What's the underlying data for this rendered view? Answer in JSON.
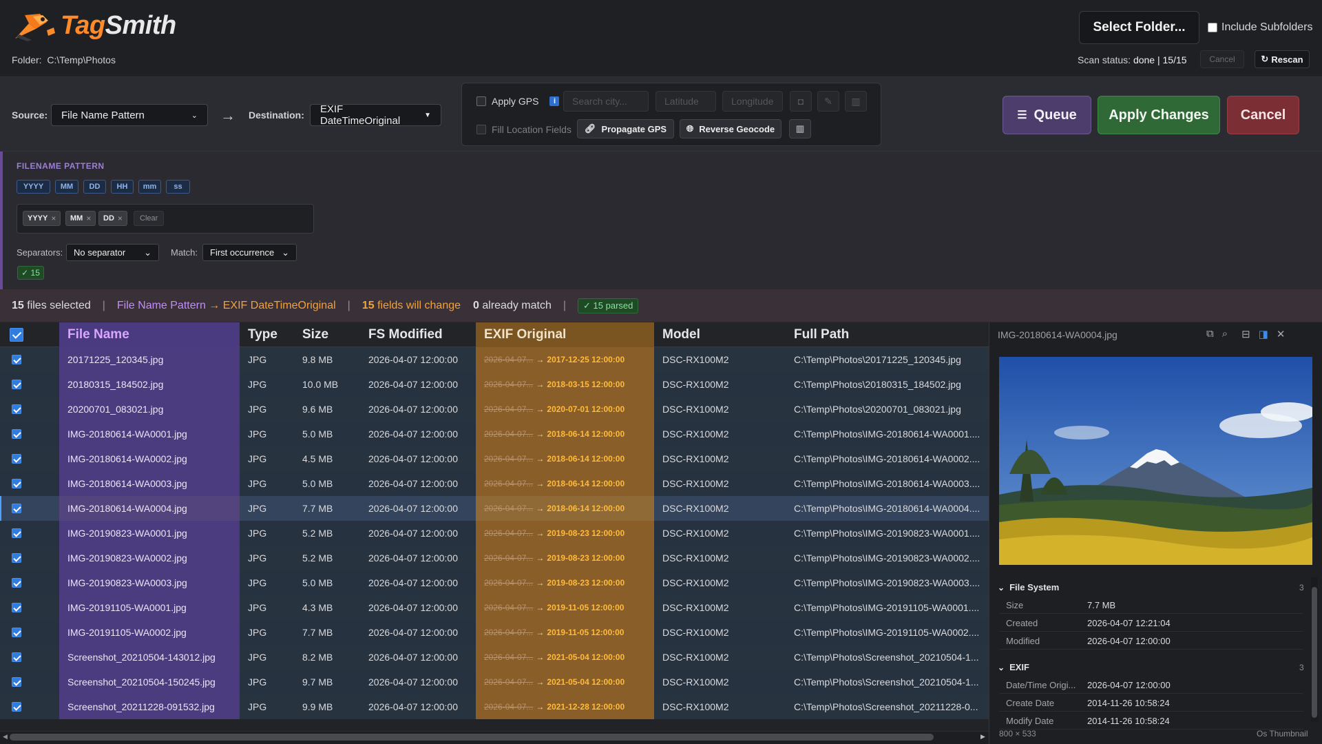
{
  "app": {
    "name_part1": "Tag",
    "name_part2": "Smith"
  },
  "header": {
    "folder_label": "Folder:",
    "folder_path": "C:\\Temp\\Photos",
    "select_folder": "Select Folder...",
    "include_subfolders": "Include Subfolders",
    "scan_status_label": "Scan status:",
    "scan_status_value": "done | 15/15",
    "cancel_small": "Cancel",
    "rescan": "Rescan"
  },
  "toolbar": {
    "source_label": "Source:",
    "source_value": "File Name Pattern",
    "destination_label": "Destination:",
    "destination_value": "EXIF DateTimeOriginal",
    "apply_gps": "Apply GPS",
    "search_city_placeholder": "Search city...",
    "latitude_placeholder": "Latitude",
    "longitude_placeholder": "Longitude",
    "fill_location": "Fill Location Fields",
    "propagate_gps": "Propagate GPS",
    "reverse_geocode": "Reverse Geocode",
    "queue": "Queue",
    "apply_changes": "Apply Changes",
    "cancel": "Cancel"
  },
  "pattern": {
    "title": "FILENAME PATTERN",
    "tokens": [
      "YYYY",
      "MM",
      "DD",
      "HH",
      "mm",
      "ss"
    ],
    "chips": [
      "YYYY",
      "MM",
      "DD"
    ],
    "clear": "Clear",
    "separators_label": "Separators:",
    "separators_value": "No separator",
    "match_label": "Match:",
    "match_value": "First occurrence",
    "parsed_badge": "✓ 15"
  },
  "summary": {
    "files_selected_count": "15",
    "files_selected_text": "files selected",
    "source": "File Name Pattern",
    "arrow": "→",
    "destination": "EXIF DateTimeOriginal",
    "fields_change_count": "15",
    "fields_change_text": "fields will change",
    "already_match_count": "0",
    "already_match_text": "already match",
    "parsed_badge": "✓ 15 parsed"
  },
  "table": {
    "headers": [
      "File Name",
      "Type",
      "Size",
      "FS Modified",
      "EXIF Original",
      "Model",
      "Full Path"
    ],
    "rows": [
      {
        "name": "20171225_120345.jpg",
        "type": "JPG",
        "size": "9.8 MB",
        "fs": "2026-04-07 12:00:00",
        "old": "2026-04-07...",
        "new": "2017-12-25 12:00:00",
        "model": "DSC-RX100M2",
        "path": "C:\\Temp\\Photos\\20171225_120345.jpg"
      },
      {
        "name": "20180315_184502.jpg",
        "type": "JPG",
        "size": "10.0 MB",
        "fs": "2026-04-07 12:00:00",
        "old": "2026-04-07...",
        "new": "2018-03-15 12:00:00",
        "model": "DSC-RX100M2",
        "path": "C:\\Temp\\Photos\\20180315_184502.jpg"
      },
      {
        "name": "20200701_083021.jpg",
        "type": "JPG",
        "size": "9.6 MB",
        "fs": "2026-04-07 12:00:00",
        "old": "2026-04-07...",
        "new": "2020-07-01 12:00:00",
        "model": "DSC-RX100M2",
        "path": "C:\\Temp\\Photos\\20200701_083021.jpg"
      },
      {
        "name": "IMG-20180614-WA0001.jpg",
        "type": "JPG",
        "size": "5.0 MB",
        "fs": "2026-04-07 12:00:00",
        "old": "2026-04-07...",
        "new": "2018-06-14 12:00:00",
        "model": "DSC-RX100M2",
        "path": "C:\\Temp\\Photos\\IMG-20180614-WA0001...."
      },
      {
        "name": "IMG-20180614-WA0002.jpg",
        "type": "JPG",
        "size": "4.5 MB",
        "fs": "2026-04-07 12:00:00",
        "old": "2026-04-07...",
        "new": "2018-06-14 12:00:00",
        "model": "DSC-RX100M2",
        "path": "C:\\Temp\\Photos\\IMG-20180614-WA0002...."
      },
      {
        "name": "IMG-20180614-WA0003.jpg",
        "type": "JPG",
        "size": "5.0 MB",
        "fs": "2026-04-07 12:00:00",
        "old": "2026-04-07...",
        "new": "2018-06-14 12:00:00",
        "model": "DSC-RX100M2",
        "path": "C:\\Temp\\Photos\\IMG-20180614-WA0003...."
      },
      {
        "name": "IMG-20180614-WA0004.jpg",
        "type": "JPG",
        "size": "7.7 MB",
        "fs": "2026-04-07 12:00:00",
        "old": "2026-04-07...",
        "new": "2018-06-14 12:00:00",
        "model": "DSC-RX100M2",
        "path": "C:\\Temp\\Photos\\IMG-20180614-WA0004...."
      },
      {
        "name": "IMG-20190823-WA0001.jpg",
        "type": "JPG",
        "size": "5.2 MB",
        "fs": "2026-04-07 12:00:00",
        "old": "2026-04-07...",
        "new": "2019-08-23 12:00:00",
        "model": "DSC-RX100M2",
        "path": "C:\\Temp\\Photos\\IMG-20190823-WA0001...."
      },
      {
        "name": "IMG-20190823-WA0002.jpg",
        "type": "JPG",
        "size": "5.2 MB",
        "fs": "2026-04-07 12:00:00",
        "old": "2026-04-07...",
        "new": "2019-08-23 12:00:00",
        "model": "DSC-RX100M2",
        "path": "C:\\Temp\\Photos\\IMG-20190823-WA0002...."
      },
      {
        "name": "IMG-20190823-WA0003.jpg",
        "type": "JPG",
        "size": "5.0 MB",
        "fs": "2026-04-07 12:00:00",
        "old": "2026-04-07...",
        "new": "2019-08-23 12:00:00",
        "model": "DSC-RX100M2",
        "path": "C:\\Temp\\Photos\\IMG-20190823-WA0003...."
      },
      {
        "name": "IMG-20191105-WA0001.jpg",
        "type": "JPG",
        "size": "4.3 MB",
        "fs": "2026-04-07 12:00:00",
        "old": "2026-04-07...",
        "new": "2019-11-05 12:00:00",
        "model": "DSC-RX100M2",
        "path": "C:\\Temp\\Photos\\IMG-20191105-WA0001...."
      },
      {
        "name": "IMG-20191105-WA0002.jpg",
        "type": "JPG",
        "size": "7.7 MB",
        "fs": "2026-04-07 12:00:00",
        "old": "2026-04-07...",
        "new": "2019-11-05 12:00:00",
        "model": "DSC-RX100M2",
        "path": "C:\\Temp\\Photos\\IMG-20191105-WA0002...."
      },
      {
        "name": "Screenshot_20210504-143012.jpg",
        "type": "JPG",
        "size": "8.2 MB",
        "fs": "2026-04-07 12:00:00",
        "old": "2026-04-07...",
        "new": "2021-05-04 12:00:00",
        "model": "DSC-RX100M2",
        "path": "C:\\Temp\\Photos\\Screenshot_20210504-1..."
      },
      {
        "name": "Screenshot_20210504-150245.jpg",
        "type": "JPG",
        "size": "9.7 MB",
        "fs": "2026-04-07 12:00:00",
        "old": "2026-04-07...",
        "new": "2021-05-04 12:00:00",
        "model": "DSC-RX100M2",
        "path": "C:\\Temp\\Photos\\Screenshot_20210504-1..."
      },
      {
        "name": "Screenshot_20211228-091532.jpg",
        "type": "JPG",
        "size": "9.9 MB",
        "fs": "2026-04-07 12:00:00",
        "old": "2026-04-07...",
        "new": "2021-12-28 12:00:00",
        "model": "DSC-RX100M2",
        "path": "C:\\Temp\\Photos\\Screenshot_20211228-0..."
      }
    ],
    "selected_row_index": 6
  },
  "preview": {
    "title": "IMG-20180614-WA0004.jpg",
    "sections": [
      {
        "name": "File System",
        "count": "3",
        "items": [
          {
            "k": "Size",
            "v": "7.7 MB"
          },
          {
            "k": "Created",
            "v": "2026-04-07 12:21:04"
          },
          {
            "k": "Modified",
            "v": "2026-04-07 12:00:00"
          }
        ]
      },
      {
        "name": "EXIF",
        "count": "3",
        "items": [
          {
            "k": "Date/Time Origi...",
            "v": "2026-04-07 12:00:00"
          },
          {
            "k": "Create Date",
            "v": "2014-11-26 10:58:24"
          },
          {
            "k": "Modify Date",
            "v": "2014-11-26 10:58:24"
          }
        ]
      }
    ],
    "dimensions": "800 × 533",
    "source": "Os Thumbnail"
  },
  "colors": {
    "accent_purple": "#c38bff",
    "accent_orange": "#f2a23a",
    "accent_blue": "#2f7de0",
    "apply_green": "#2f6a36",
    "cancel_red": "#7b2f35"
  }
}
